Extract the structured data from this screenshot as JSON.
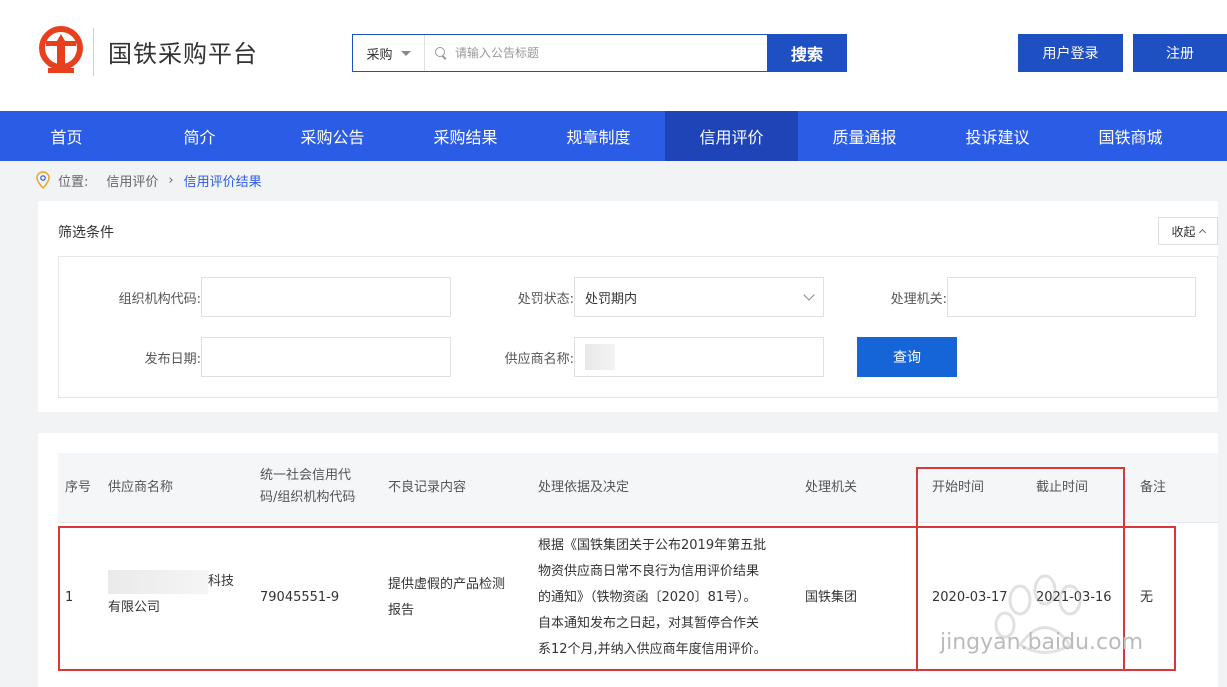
{
  "header": {
    "site_title": "国铁采购平台",
    "search": {
      "category": "采购",
      "placeholder": "请输入公告标题",
      "button": "搜索"
    },
    "login": "用户登录",
    "register": "注册"
  },
  "nav": {
    "items": [
      "首页",
      "简介",
      "采购公告",
      "采购结果",
      "规章制度",
      "信用评价",
      "质量通报",
      "投诉建议",
      "国铁商城"
    ],
    "active_index": 5
  },
  "breadcrumb": {
    "prefix": "位置:",
    "level1": "信用评价",
    "level2": "信用评价结果"
  },
  "filter": {
    "title": "筛选条件",
    "collapse": "收起",
    "org_code_label": "组织机构代码:",
    "penalty_status_label": "处罚状态:",
    "penalty_status_value": "处罚期内",
    "authority_label": "处理机关:",
    "publish_date_label": "发布日期:",
    "supplier_label": "供应商名称:",
    "query_button": "查询"
  },
  "table": {
    "headers": {
      "index": "序号",
      "supplier": "供应商名称",
      "credit_code_line1": "统一社会信用代",
      "credit_code_line2": "码/组织机构代码",
      "bad_record": "不良记录内容",
      "basis": "处理依据及决定",
      "authority": "处理机关",
      "start": "开始时间",
      "end": "截止时间",
      "remark": "备注"
    },
    "rows": [
      {
        "index": "1",
        "supplier_line1_tail": "科技",
        "supplier_line2": "有限公司",
        "credit_code": "79045551-9",
        "bad_record_line1": "提供虚假的产品检测",
        "bad_record_line2": "报告",
        "basis_lines": [
          "根据《国铁集团关于公布2019年第五批",
          "物资供应商日常不良行为信用评价结果",
          "的通知》（铁物资函〔2020〕81号）。",
          "自本通知发布之日起，对其暂停合作关",
          "系12个月,并纳入供应商年度信用评价。"
        ],
        "authority": "国铁集团",
        "start": "2020-03-17",
        "end": "2021-03-16",
        "remark": "无"
      }
    ]
  },
  "watermark": "jingyan.baidu.com"
}
